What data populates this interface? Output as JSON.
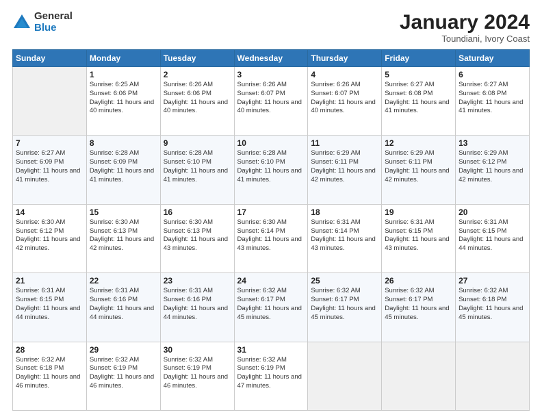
{
  "logo": {
    "general": "General",
    "blue": "Blue"
  },
  "header": {
    "month": "January 2024",
    "location": "Toundiani, Ivory Coast"
  },
  "weekdays": [
    "Sunday",
    "Monday",
    "Tuesday",
    "Wednesday",
    "Thursday",
    "Friday",
    "Saturday"
  ],
  "weeks": [
    [
      {
        "day": "",
        "sunrise": "",
        "sunset": "",
        "daylight": ""
      },
      {
        "day": "1",
        "sunrise": "Sunrise: 6:25 AM",
        "sunset": "Sunset: 6:06 PM",
        "daylight": "Daylight: 11 hours and 40 minutes."
      },
      {
        "day": "2",
        "sunrise": "Sunrise: 6:26 AM",
        "sunset": "Sunset: 6:06 PM",
        "daylight": "Daylight: 11 hours and 40 minutes."
      },
      {
        "day": "3",
        "sunrise": "Sunrise: 6:26 AM",
        "sunset": "Sunset: 6:07 PM",
        "daylight": "Daylight: 11 hours and 40 minutes."
      },
      {
        "day": "4",
        "sunrise": "Sunrise: 6:26 AM",
        "sunset": "Sunset: 6:07 PM",
        "daylight": "Daylight: 11 hours and 40 minutes."
      },
      {
        "day": "5",
        "sunrise": "Sunrise: 6:27 AM",
        "sunset": "Sunset: 6:08 PM",
        "daylight": "Daylight: 11 hours and 41 minutes."
      },
      {
        "day": "6",
        "sunrise": "Sunrise: 6:27 AM",
        "sunset": "Sunset: 6:08 PM",
        "daylight": "Daylight: 11 hours and 41 minutes."
      }
    ],
    [
      {
        "day": "7",
        "sunrise": "Sunrise: 6:27 AM",
        "sunset": "Sunset: 6:09 PM",
        "daylight": "Daylight: 11 hours and 41 minutes."
      },
      {
        "day": "8",
        "sunrise": "Sunrise: 6:28 AM",
        "sunset": "Sunset: 6:09 PM",
        "daylight": "Daylight: 11 hours and 41 minutes."
      },
      {
        "day": "9",
        "sunrise": "Sunrise: 6:28 AM",
        "sunset": "Sunset: 6:10 PM",
        "daylight": "Daylight: 11 hours and 41 minutes."
      },
      {
        "day": "10",
        "sunrise": "Sunrise: 6:28 AM",
        "sunset": "Sunset: 6:10 PM",
        "daylight": "Daylight: 11 hours and 41 minutes."
      },
      {
        "day": "11",
        "sunrise": "Sunrise: 6:29 AM",
        "sunset": "Sunset: 6:11 PM",
        "daylight": "Daylight: 11 hours and 42 minutes."
      },
      {
        "day": "12",
        "sunrise": "Sunrise: 6:29 AM",
        "sunset": "Sunset: 6:11 PM",
        "daylight": "Daylight: 11 hours and 42 minutes."
      },
      {
        "day": "13",
        "sunrise": "Sunrise: 6:29 AM",
        "sunset": "Sunset: 6:12 PM",
        "daylight": "Daylight: 11 hours and 42 minutes."
      }
    ],
    [
      {
        "day": "14",
        "sunrise": "Sunrise: 6:30 AM",
        "sunset": "Sunset: 6:12 PM",
        "daylight": "Daylight: 11 hours and 42 minutes."
      },
      {
        "day": "15",
        "sunrise": "Sunrise: 6:30 AM",
        "sunset": "Sunset: 6:13 PM",
        "daylight": "Daylight: 11 hours and 42 minutes."
      },
      {
        "day": "16",
        "sunrise": "Sunrise: 6:30 AM",
        "sunset": "Sunset: 6:13 PM",
        "daylight": "Daylight: 11 hours and 43 minutes."
      },
      {
        "day": "17",
        "sunrise": "Sunrise: 6:30 AM",
        "sunset": "Sunset: 6:14 PM",
        "daylight": "Daylight: 11 hours and 43 minutes."
      },
      {
        "day": "18",
        "sunrise": "Sunrise: 6:31 AM",
        "sunset": "Sunset: 6:14 PM",
        "daylight": "Daylight: 11 hours and 43 minutes."
      },
      {
        "day": "19",
        "sunrise": "Sunrise: 6:31 AM",
        "sunset": "Sunset: 6:15 PM",
        "daylight": "Daylight: 11 hours and 43 minutes."
      },
      {
        "day": "20",
        "sunrise": "Sunrise: 6:31 AM",
        "sunset": "Sunset: 6:15 PM",
        "daylight": "Daylight: 11 hours and 44 minutes."
      }
    ],
    [
      {
        "day": "21",
        "sunrise": "Sunrise: 6:31 AM",
        "sunset": "Sunset: 6:15 PM",
        "daylight": "Daylight: 11 hours and 44 minutes."
      },
      {
        "day": "22",
        "sunrise": "Sunrise: 6:31 AM",
        "sunset": "Sunset: 6:16 PM",
        "daylight": "Daylight: 11 hours and 44 minutes."
      },
      {
        "day": "23",
        "sunrise": "Sunrise: 6:31 AM",
        "sunset": "Sunset: 6:16 PM",
        "daylight": "Daylight: 11 hours and 44 minutes."
      },
      {
        "day": "24",
        "sunrise": "Sunrise: 6:32 AM",
        "sunset": "Sunset: 6:17 PM",
        "daylight": "Daylight: 11 hours and 45 minutes."
      },
      {
        "day": "25",
        "sunrise": "Sunrise: 6:32 AM",
        "sunset": "Sunset: 6:17 PM",
        "daylight": "Daylight: 11 hours and 45 minutes."
      },
      {
        "day": "26",
        "sunrise": "Sunrise: 6:32 AM",
        "sunset": "Sunset: 6:17 PM",
        "daylight": "Daylight: 11 hours and 45 minutes."
      },
      {
        "day": "27",
        "sunrise": "Sunrise: 6:32 AM",
        "sunset": "Sunset: 6:18 PM",
        "daylight": "Daylight: 11 hours and 45 minutes."
      }
    ],
    [
      {
        "day": "28",
        "sunrise": "Sunrise: 6:32 AM",
        "sunset": "Sunset: 6:18 PM",
        "daylight": "Daylight: 11 hours and 46 minutes."
      },
      {
        "day": "29",
        "sunrise": "Sunrise: 6:32 AM",
        "sunset": "Sunset: 6:19 PM",
        "daylight": "Daylight: 11 hours and 46 minutes."
      },
      {
        "day": "30",
        "sunrise": "Sunrise: 6:32 AM",
        "sunset": "Sunset: 6:19 PM",
        "daylight": "Daylight: 11 hours and 46 minutes."
      },
      {
        "day": "31",
        "sunrise": "Sunrise: 6:32 AM",
        "sunset": "Sunset: 6:19 PM",
        "daylight": "Daylight: 11 hours and 47 minutes."
      },
      {
        "day": "",
        "sunrise": "",
        "sunset": "",
        "daylight": ""
      },
      {
        "day": "",
        "sunrise": "",
        "sunset": "",
        "daylight": ""
      },
      {
        "day": "",
        "sunrise": "",
        "sunset": "",
        "daylight": ""
      }
    ]
  ]
}
